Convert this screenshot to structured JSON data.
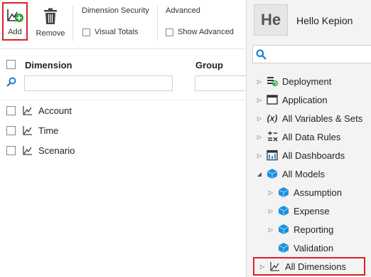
{
  "toolbar": {
    "add_label": "Add",
    "remove_label": "Remove",
    "dimension_security_label": "Dimension Security",
    "visual_totals_label": "Visual Totals",
    "advanced_label": "Advanced",
    "show_advanced_label": "Show Advanced"
  },
  "grid": {
    "headers": {
      "dimension": "Dimension",
      "group": "Group"
    },
    "rows": [
      {
        "label": "Account"
      },
      {
        "label": "Time"
      },
      {
        "label": "Scenario"
      }
    ]
  },
  "user": {
    "avatar_text": "He",
    "greeting": "Hello Kepion"
  },
  "tree": {
    "items": [
      {
        "label": "Deployment",
        "icon": "deployment-icon"
      },
      {
        "label": "Application",
        "icon": "application-icon"
      },
      {
        "label": "All Variables & Sets",
        "icon": "variables-icon"
      },
      {
        "label": "All Data Rules",
        "icon": "data-rules-icon"
      },
      {
        "label": "All Dashboards",
        "icon": "dashboards-icon"
      },
      {
        "label": "All Models",
        "icon": "cube-icon",
        "expanded": true
      },
      {
        "label": "Assumption",
        "icon": "cube-icon"
      },
      {
        "label": "Expense",
        "icon": "cube-icon"
      },
      {
        "label": "Reporting",
        "icon": "cube-icon"
      },
      {
        "label": "Validation",
        "icon": "cube-icon"
      },
      {
        "label": "All Dimensions",
        "icon": "dimension-icon"
      }
    ]
  },
  "colors": {
    "highlight": "#d8232a",
    "cube": "#1d8fe0",
    "add_plus": "#2e9e3a"
  }
}
